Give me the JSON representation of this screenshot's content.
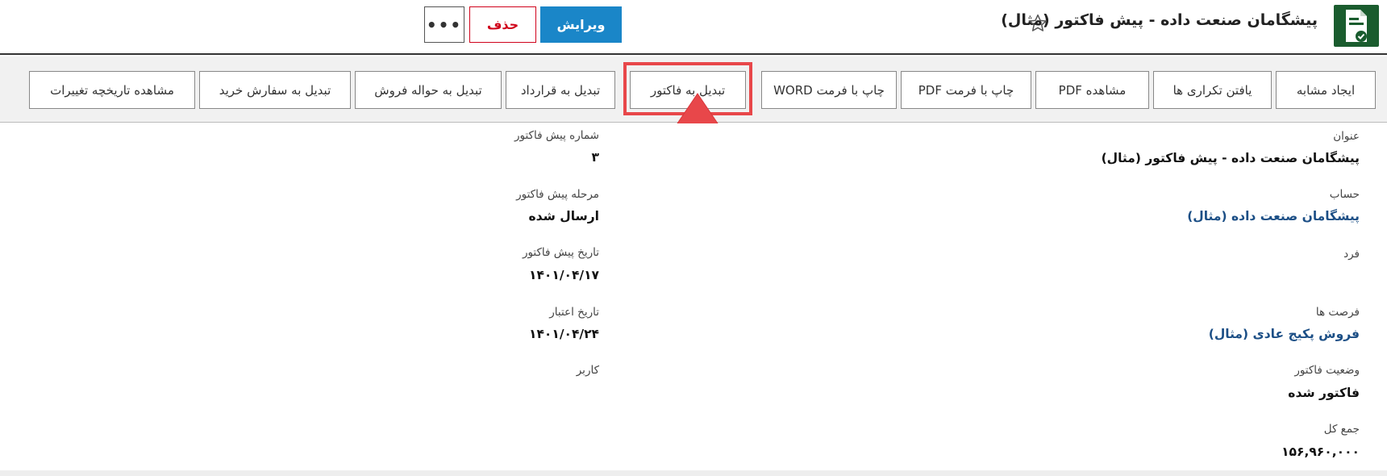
{
  "header": {
    "title": "پیشگامان صنعت داده - پیش فاکتور (مثال)",
    "edit_label": "ویرایش",
    "delete_label": "حذف",
    "more_label": "•••"
  },
  "toolbar": {
    "buttons": [
      "ایجاد مشابه",
      "یافتن تکراری ها",
      "مشاهده PDF",
      "چاپ با فرمت PDF",
      "چاپ با فرمت WORD",
      "تبدیل به فاکتور",
      "تبدیل به  قرارداد",
      "تبدیل به حواله فروش",
      "تبدیل به سفارش خرید",
      "مشاهده تاریخچه تغییرات"
    ]
  },
  "fields": {
    "right": [
      {
        "label": "عنوان",
        "value": "پیشگامان صنعت داده - پیش فاکتور (مثال)"
      },
      {
        "label": "حساب",
        "value": "پیشگامان صنعت داده (مثال)"
      },
      {
        "label": "فرد",
        "value": ""
      },
      {
        "label": "فرصت ها",
        "value": "فروش پکیج عادی (مثال)"
      },
      {
        "label": "وضعیت فاکتور",
        "value": "فاکتور شده"
      },
      {
        "label": "جمع کل",
        "value": "۱۵۶,۹۶۰,۰۰۰"
      }
    ],
    "left": [
      {
        "label": "شماره پیش فاکتور",
        "value": "۳"
      },
      {
        "label": "مرحله پیش فاکتور",
        "value": "ارسال شده"
      },
      {
        "label": "تاریخ پیش فاکتور",
        "value": "۱۴۰۱/۰۴/۱۷"
      },
      {
        "label": "تاریخ اعتبار",
        "value": "۱۴۰۱/۰۴/۲۴"
      },
      {
        "label": "کاربر",
        "value": ""
      }
    ]
  },
  "colors": {
    "accent_blue": "#1a86c8",
    "delete_red": "#d0021b",
    "highlight_red": "#e8474a",
    "link_blue": "#1c4f86",
    "icon_green": "#1a5c2e"
  },
  "highlighted_button": "تبدیل به فاکتور"
}
